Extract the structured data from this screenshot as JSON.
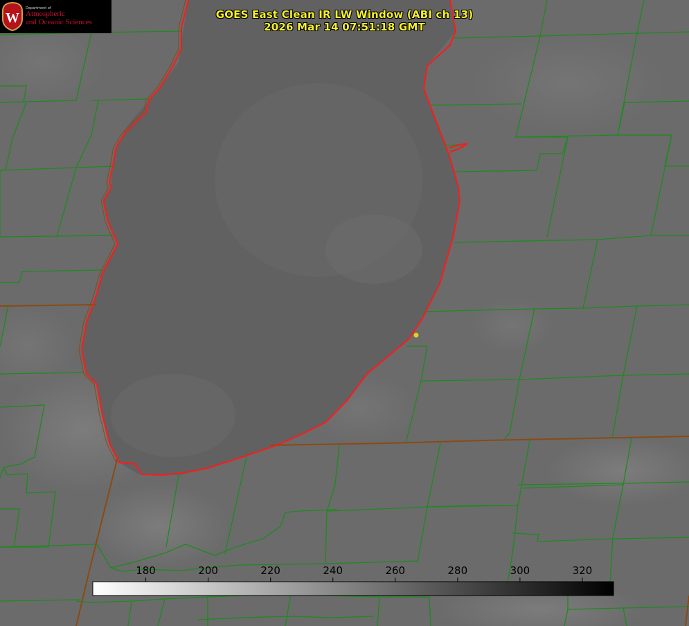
{
  "logo": {
    "department": "Department of",
    "line1": "Atmospheric",
    "line2": "and Oceanic Sciences",
    "seal_letter": "W"
  },
  "title": {
    "line1": "GOES East Clean IR LW Window (ABI ch 13)",
    "line2": "2026 Mar 14 07:51:18 GMT"
  },
  "colorbar": {
    "ticks": [
      180,
      200,
      220,
      240,
      260,
      280,
      300,
      320
    ],
    "range": [
      163,
      330
    ],
    "colormap": "grayscale-inverted",
    "tick_color": "#000000"
  },
  "colors": {
    "background": "#6b6b6b",
    "lake": "#616161",
    "county_lines": "#1e8a1e",
    "shoreline": "#ff1a1a",
    "state_lines": "#8a4a14",
    "marker": "#e0d020",
    "title_text": "#f5ef2a"
  },
  "map": {
    "region": "Lake Michigan",
    "marker_icon": "station-dot-icon"
  }
}
